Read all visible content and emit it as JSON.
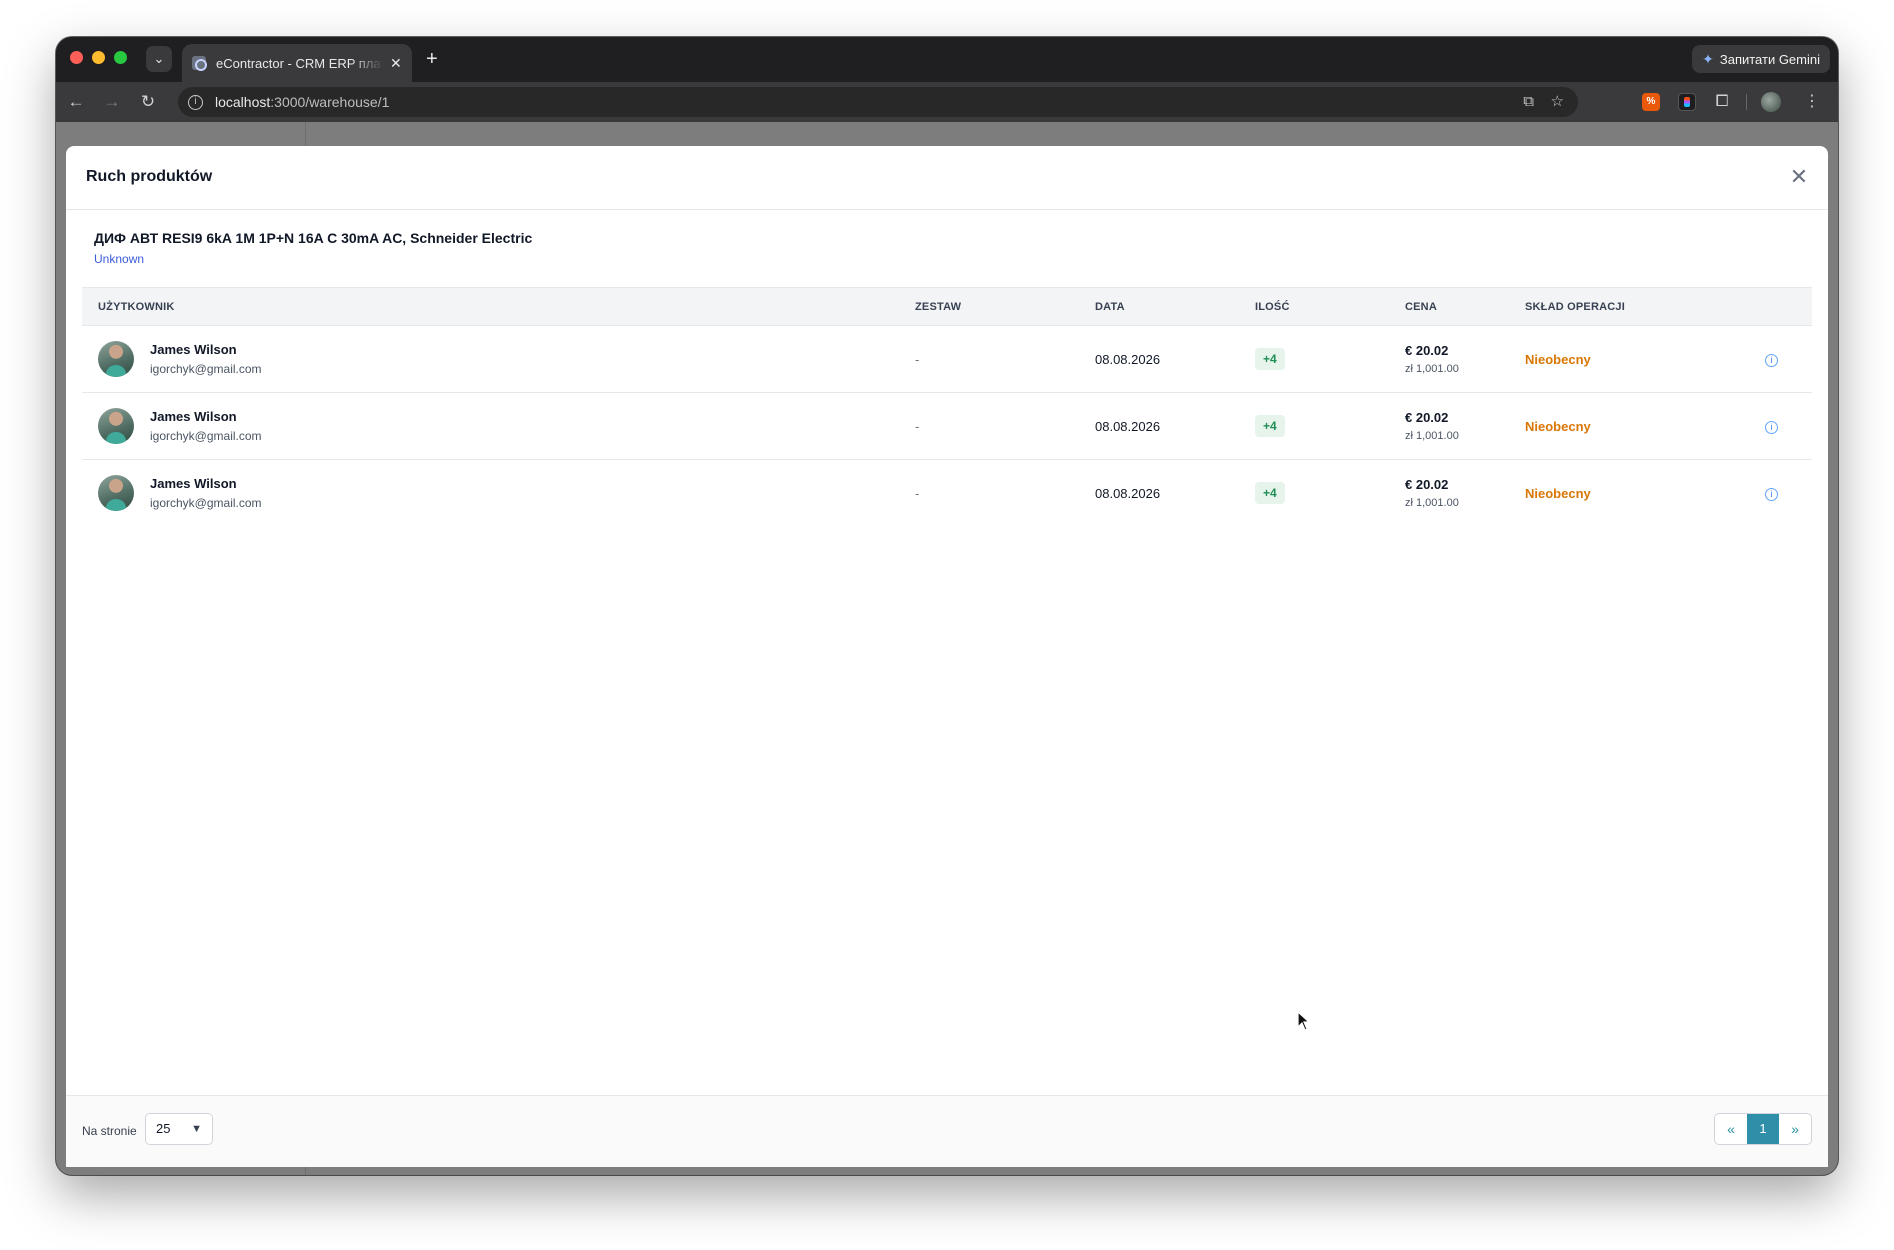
{
  "browser": {
    "tab_title": "eContractor - CRM ERP платформа",
    "gemini_label": "Запитати Gemini",
    "url_host": "localhost",
    "url_path": ":3000/warehouse/1"
  },
  "modal": {
    "title": "Ruch produktów",
    "product_name": "ДИФ АВТ RESI9 6kA 1M 1P+N 16A C 30mA AC, Schneider Electric",
    "product_status": "Unknown",
    "columns": [
      "UŻYTKOWNIK",
      "ZESTAW",
      "DATA",
      "ILOŚĆ",
      "CENA",
      "SKŁAD OPERACJI"
    ],
    "rows": [
      {
        "user_name": "James Wilson",
        "user_email": "igorchyk@gmail.com",
        "set": "-",
        "date": "08.08.2026",
        "quantity": "+4",
        "price": "€ 20.02",
        "price_local": "zł 1,001.00",
        "operation_status": "Nieobecny"
      },
      {
        "user_name": "James Wilson",
        "user_email": "igorchyk@gmail.com",
        "set": "-",
        "date": "08.08.2026",
        "quantity": "+4",
        "price": "€ 20.02",
        "price_local": "zł 1,001.00",
        "operation_status": "Nieobecny"
      },
      {
        "user_name": "James Wilson",
        "user_email": "igorchyk@gmail.com",
        "set": "-",
        "date": "08.08.2026",
        "quantity": "+4",
        "price": "€ 20.02",
        "price_local": "zł 1,001.00",
        "operation_status": "Nieobecny"
      }
    ],
    "footer": {
      "per_page_label": "Na stronie",
      "per_page_value": "25",
      "pager_prev": "«",
      "pager_current": "1",
      "pager_next": "»"
    }
  },
  "colors": {
    "accent": "#2f8fa8",
    "warning": "#d97706",
    "success": "#1f8f55",
    "link": "#3b5bdb"
  },
  "icons": [
    "chevron-down-icon",
    "close-icon",
    "back-icon",
    "forward-icon",
    "reload-icon",
    "info-icon",
    "star-icon",
    "install-icon",
    "puzzle-icon",
    "kebab-icon",
    "row-info-icon",
    "cursor-icon"
  ]
}
